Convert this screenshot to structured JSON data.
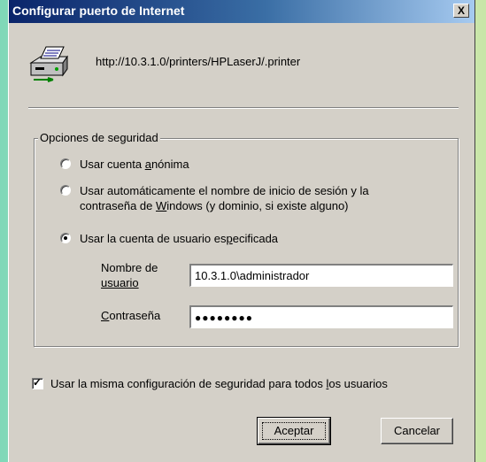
{
  "window": {
    "title": "Configurar puerto de Internet",
    "close_label": "X"
  },
  "printer": {
    "icon": "printer-icon",
    "url": "http://10.3.1.0/printers/HPLaserJ/.printer"
  },
  "security": {
    "group_title": "Opciones de seguridad",
    "options": [
      {
        "label": "Usar cuenta anónima",
        "checked": false
      },
      {
        "label": "Usar automáticamente el nombre de inicio de sesión y la",
        "label_line2": "contraseña de Windows (y dominio, si existe alguno)",
        "checked": false
      },
      {
        "label": "Usar la cuenta de usuario especificada",
        "checked": true
      }
    ],
    "username_label_line1": "Nombre de",
    "username_label_line2": "usuario",
    "username_value": "10.3.1.0\\administrador",
    "password_label": "Contraseña",
    "password_value": "●●●●●●●●"
  },
  "same_config": {
    "label": "Usar la misma configuración de seguridad para todos los usuarios",
    "checked": true
  },
  "buttons": {
    "ok": "Aceptar",
    "cancel": "Cancelar"
  }
}
